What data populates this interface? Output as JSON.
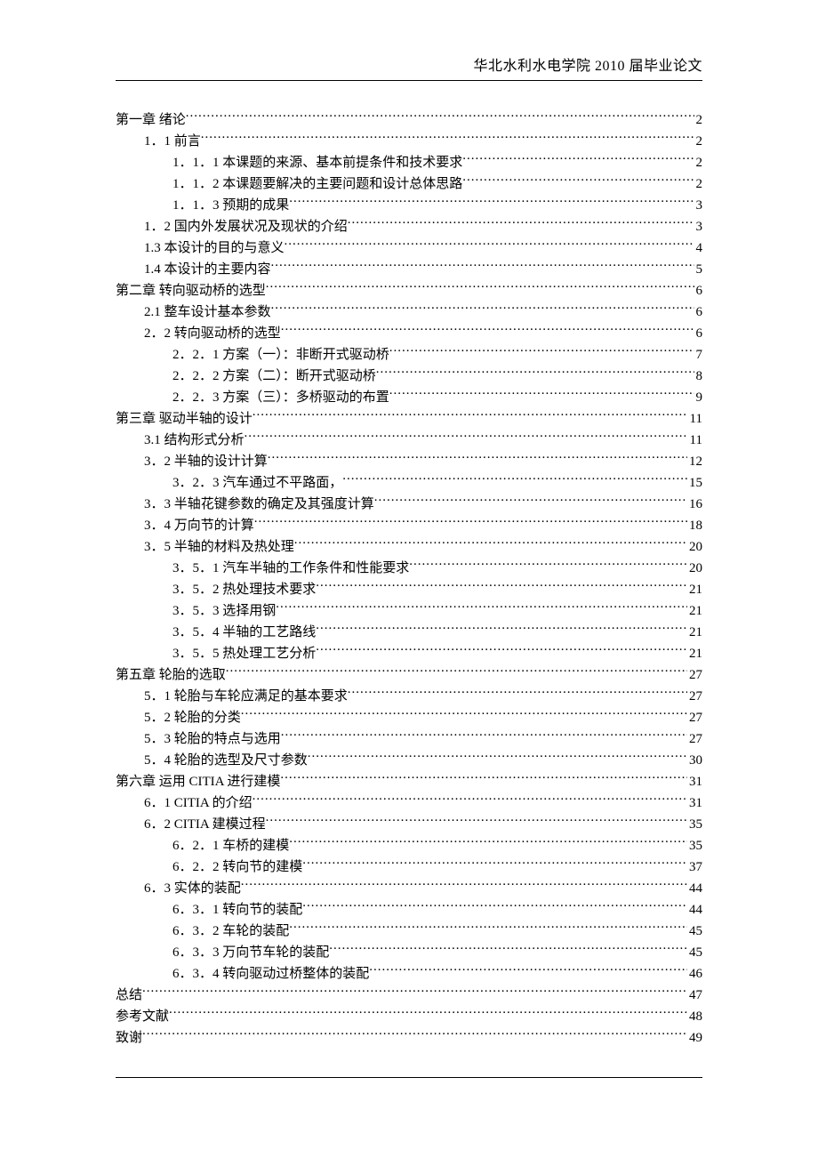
{
  "header": "华北水利水电学院 2010 届毕业论文",
  "toc": [
    {
      "level": 0,
      "label": "第一章  绪论",
      "page": "2"
    },
    {
      "level": 1,
      "label": "1．1  前言",
      "page": "2"
    },
    {
      "level": 2,
      "label": "1．1．1  本课题的来源、基本前提条件和技术要求",
      "page": "2"
    },
    {
      "level": 2,
      "label": "1．1．2  本课题要解决的主要问题和设计总体思路",
      "page": "2"
    },
    {
      "level": 2,
      "label": "1．1．3  预期的成果",
      "page": "3"
    },
    {
      "level": 1,
      "label": "1．2  国内外发展状况及现状的介绍",
      "page": "3"
    },
    {
      "level": 1,
      "label": "1.3  本设计的目的与意义",
      "page": "4"
    },
    {
      "level": 1,
      "label": "1.4  本设计的主要内容",
      "page": "5"
    },
    {
      "level": 0,
      "label": "第二章  转向驱动桥的选型",
      "page": "6"
    },
    {
      "level": 1,
      "label": "2.1  整车设计基本参数",
      "page": "6"
    },
    {
      "level": 1,
      "label": "2．2  转向驱动桥的选型",
      "page": "6"
    },
    {
      "level": 2,
      "label": "2．2．1  方案（一）：非断开式驱动桥",
      "page": "7"
    },
    {
      "level": 2,
      "label": "2．2．2  方案（二）：断开式驱动桥",
      "page": "8"
    },
    {
      "level": 2,
      "label": "2．2．3  方案（三）：多桥驱动的布置",
      "page": "9"
    },
    {
      "level": 0,
      "label": "第三章    驱动半轴的设计",
      "page": "11"
    },
    {
      "level": 1,
      "label": "3.1 结构形式分析",
      "page": "11"
    },
    {
      "level": 1,
      "label": "3．2 半轴的设计计算",
      "page": "12"
    },
    {
      "level": 2,
      "label": "3．2．3 汽车通过不平路面，",
      "page": "15"
    },
    {
      "level": 1,
      "label": "3．3  半轴花键参数的确定及其强度计算",
      "page": "16"
    },
    {
      "level": 1,
      "label": "3．4  万向节的计算",
      "page": "18"
    },
    {
      "level": 1,
      "label": "3．5  半轴的材料及热处理",
      "page": "20"
    },
    {
      "level": 2,
      "label": "3．5．1  汽车半轴的工作条件和性能要求",
      "page": "20"
    },
    {
      "level": 2,
      "label": "3．5．2  热处理技术要求",
      "page": "21"
    },
    {
      "level": 2,
      "label": "3．5．3  选择用钢",
      "page": "21"
    },
    {
      "level": 2,
      "label": "3．5．4  半轴的工艺路线",
      "page": "21"
    },
    {
      "level": 2,
      "label": "3．5．5  热处理工艺分析",
      "page": "21"
    },
    {
      "level": 0,
      "label": "第五章  轮胎的选取",
      "page": "27"
    },
    {
      "level": 1,
      "label": "5．1  轮胎与车轮应满足的基本要求",
      "page": "27"
    },
    {
      "level": 1,
      "label": "5．2  轮胎的分类",
      "page": "27"
    },
    {
      "level": 1,
      "label": "5．3  轮胎的特点与选用",
      "page": "27"
    },
    {
      "level": 1,
      "label": "5．4  轮胎的选型及尺寸参数",
      "page": "30"
    },
    {
      "level": 0,
      "label": "第六章    运用 CITIA 进行建模",
      "page": "31"
    },
    {
      "level": 1,
      "label": "6．1  CITIA 的介绍",
      "page": "31"
    },
    {
      "level": 1,
      "label": "6．2  CITIA 建模过程",
      "page": "35"
    },
    {
      "level": 2,
      "label": "6．2．1  车桥的建模",
      "page": "35"
    },
    {
      "level": 2,
      "label": "6．2．2  转向节的建模",
      "page": "37"
    },
    {
      "level": 1,
      "label": "6．3  实体的装配",
      "page": "44"
    },
    {
      "level": 2,
      "label": "6．3．1  转向节的装配",
      "page": "44"
    },
    {
      "level": 2,
      "label": "6．3．2  车轮的装配",
      "page": "45"
    },
    {
      "level": 2,
      "label": "6．3．3  万向节车轮的装配",
      "page": "45"
    },
    {
      "level": 2,
      "label": "6．3．4  转向驱动过桥整体的装配",
      "page": "46"
    },
    {
      "level": 0,
      "label": "总结",
      "page": "47"
    },
    {
      "level": 0,
      "label": "参考文献",
      "page": "48"
    },
    {
      "level": 0,
      "label": "致谢",
      "page": "49"
    }
  ]
}
